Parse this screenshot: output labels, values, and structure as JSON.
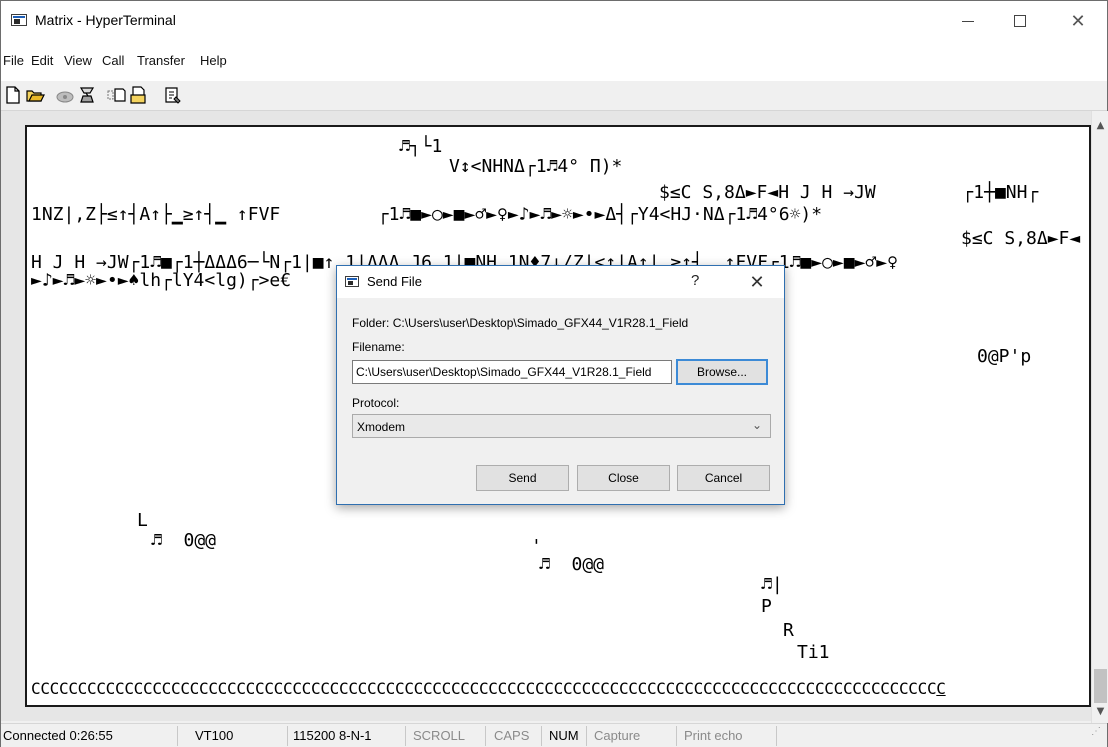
{
  "window": {
    "title": "Matrix - HyperTerminal"
  },
  "menu": [
    "File",
    "Edit",
    "View",
    "Call",
    "Transfer",
    "Help"
  ],
  "toolbar": {
    "icons": [
      "new-icon",
      "open-icon",
      "call-icon",
      "disconnect-icon",
      "send-icon",
      "receive-icon",
      "properties-icon"
    ]
  },
  "terminal": {
    "lines": [
      "♬┐└1",
      "V↕<NHNΔ┌1♬4° Π)*",
      "$≤C S,8Δ►F◄H J H →JW        ┌1┼■NH┌",
      "1NZ|,Z├≤↑┤A↑├▁≥↑┤▁ ↑FVF         ┌1♬■►○►■►♂►♀►♪►♬►☼►•►Δ┤┌Y4<HJ·NΔ┌1♬4°6☼)*",
      "$≤C S,8Δ►F◄",
      "H J H →JW┌1♬■┌1┼ΔΔΔ6─└N┌1|■↑ 1|ΔΔΔ J6 1|■NH 1N♦7↓/Z|<↑|A↑|▁≥↑┤▁ ↑FVF┌1♬■►○►■►♂►♀",
      "►♪►♬►☼►•►♠lh┌lY4<lg)┌>e€",
      "0@P'p",
      "L",
      "♬  0@@",
      "'",
      "♬  0@@",
      "♬|",
      "P",
      "R",
      "Ti1",
      "CCCCCCCCCCCCCCCCCCCCCCCCCCCCCCCCCCCCCCCCCCCCCCCCCCCCCCCCCCCCCCCCCCCCCCCCCCCCCCCCCCCCCCCCCCCCCCCCC",
      "C"
    ]
  },
  "dialog": {
    "title": "Send File",
    "help": "?",
    "folder_label": "Folder:",
    "folder_value": "C:\\Users\\user\\Desktop\\Simado_GFX44_V1R28.1_Field",
    "filename_label": "Filename:",
    "filename_value": "C:\\Users\\user\\Desktop\\Simado_GFX44_V1R28.1_Field",
    "browse_label": "Browse...",
    "protocol_label": "Protocol:",
    "protocol_value": "Xmodem",
    "send_label": "Send",
    "close_label": "Close",
    "cancel_label": "Cancel"
  },
  "status": {
    "connected": "Connected 0:26:55",
    "emulation": "VT100",
    "settings": "115200 8-N-1",
    "scroll": "SCROLL",
    "caps": "CAPS",
    "num": "NUM",
    "capture": "Capture",
    "print_echo": "Print echo"
  }
}
